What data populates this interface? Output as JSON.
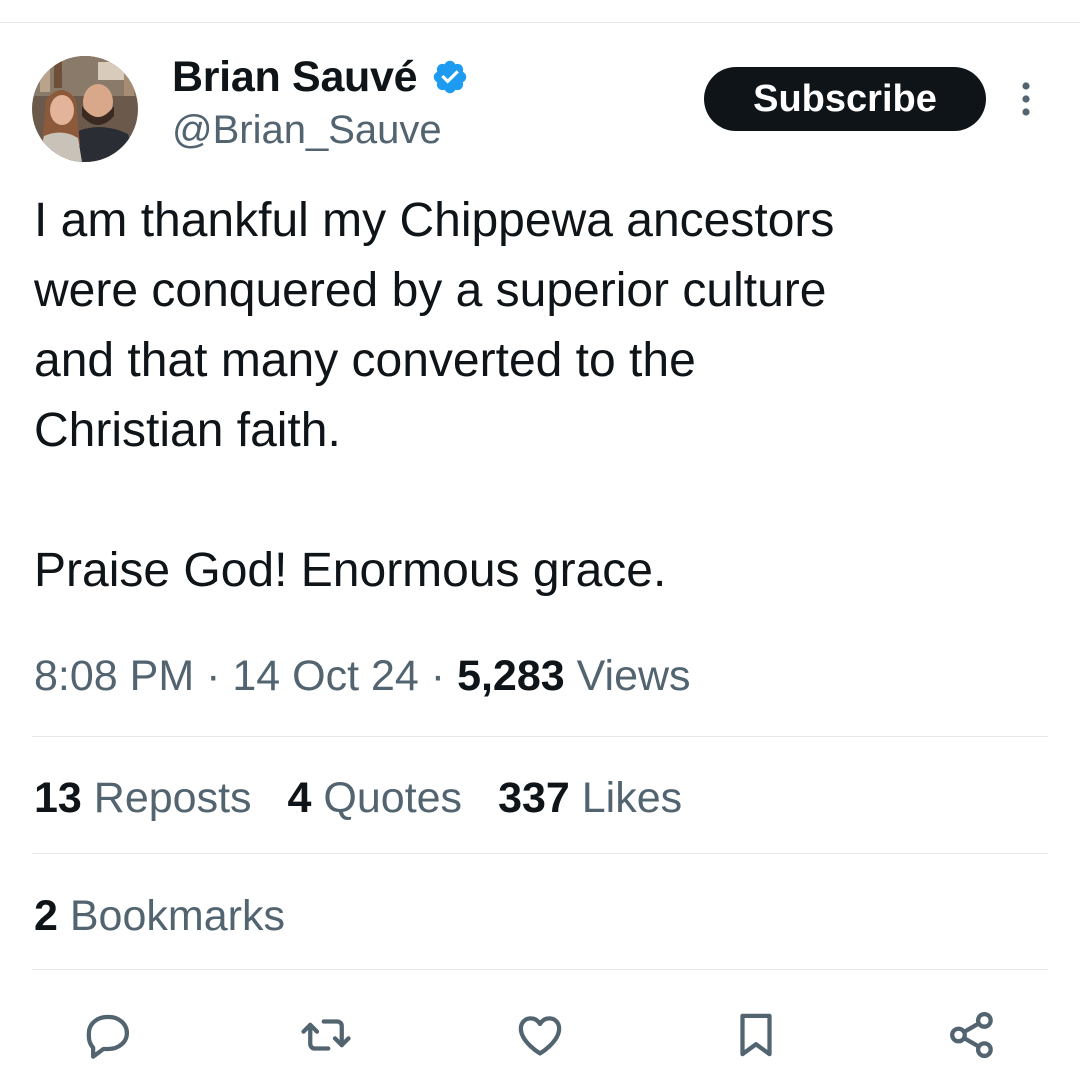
{
  "author": {
    "display_name": "Brian Sauvé",
    "handle": "@Brian_Sauve",
    "verified": true,
    "verified_color": "#1d9bf0",
    "avatar_icon": "profile-photo-avatar"
  },
  "header": {
    "subscribe_label": "Subscribe",
    "more_icon": "more-vertical-icon"
  },
  "tweet": {
    "lines": [
      "I am thankful my Chippewa ancestors",
      "were conquered by a superior culture",
      "and that many converted to the",
      "Christian faith."
    ],
    "closing": "Praise God! Enormous grace."
  },
  "meta": {
    "time": "8:08 PM",
    "date": "14 Oct 24",
    "separator": "·",
    "views_count": "5,283",
    "views_label": "Views"
  },
  "stats": {
    "reposts_count": "13",
    "reposts_label": "Reposts",
    "quotes_count": "4",
    "quotes_label": "Quotes",
    "likes_count": "337",
    "likes_label": "Likes",
    "bookmarks_count": "2",
    "bookmarks_label": "Bookmarks"
  },
  "actions": [
    "reply-icon",
    "repost-icon",
    "like-icon",
    "bookmark-icon",
    "share-icon"
  ],
  "colors": {
    "text_primary": "#0f1419",
    "text_secondary": "#536471",
    "divider": "#e6e9ec",
    "icon": "#536471"
  }
}
